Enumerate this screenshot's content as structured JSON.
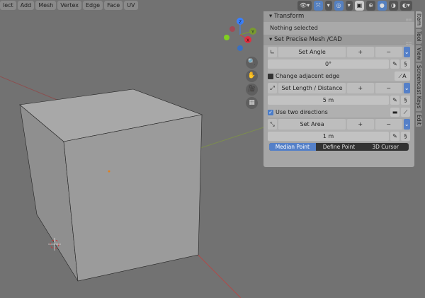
{
  "menu": [
    "lect",
    "Add",
    "Mesh",
    "Vertex",
    "Edge",
    "Face",
    "UV"
  ],
  "gizmo": {
    "z": "Z",
    "y": "Y",
    "x": "X"
  },
  "transform": {
    "title": "Transform",
    "status": "Nothing selected"
  },
  "cad": {
    "title": "Set Precise Mesh /CAD",
    "angle": {
      "label": "Set Angle",
      "plus": "+",
      "minus": "−",
      "value": "0°",
      "check": "Change adjacent edge",
      "tool": "A"
    },
    "length": {
      "label": "Set Length / Distance",
      "plus": "+",
      "minus": "−",
      "value": "5 m",
      "check": "Use two directions"
    },
    "area": {
      "label": "Set Area",
      "plus": "+",
      "minus": "−",
      "value": "1 m"
    },
    "pivot": [
      "Median Point",
      "Define Point",
      "3D Cursor"
    ]
  },
  "tabs": [
    "Item",
    "Tool",
    "View",
    "Screencast Keys",
    "Edit"
  ]
}
